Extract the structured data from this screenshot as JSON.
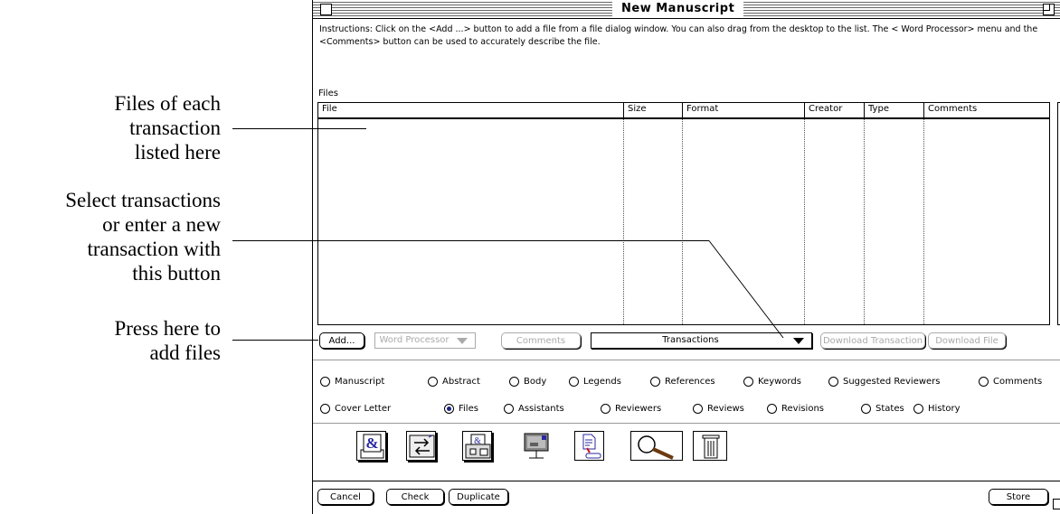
{
  "callouts": {
    "files": [
      "Files of each",
      "transaction",
      "listed here"
    ],
    "transactions": [
      "Select transactions",
      "or enter a new",
      "transaction with",
      "this button"
    ],
    "add": [
      "Press here to",
      "add files"
    ]
  },
  "window": {
    "title": "New Manuscript",
    "instructions": "Instructions: Click on the <Add ...> button to add a file from a file dialog window.  You can also drag from the desktop to the list.  The < Word Processor> menu and the <Comments> button can be used to accurately describe the file."
  },
  "files": {
    "label": "Files",
    "columns": [
      "File",
      "Size",
      "Format",
      "Creator",
      "Type",
      "Comments"
    ],
    "rows": []
  },
  "buttons": {
    "add": "Add...",
    "word_processor": "Word Processor",
    "comments": "Comments",
    "transactions": "Transactions",
    "download_transaction": "Download Transaction",
    "download_file": "Download File",
    "cancel": "Cancel",
    "check": "Check",
    "duplicate": "Duplicate",
    "store": "Store"
  },
  "sections_row1": [
    "Manuscript",
    "Abstract",
    "Body",
    "Legends",
    "References",
    "Keywords",
    "Suggested Reviewers",
    "Comments"
  ],
  "sections_row2": [
    "Cover Letter",
    "Files",
    "Assistants",
    "Reviewers",
    "Reviews",
    "Revisions",
    "States",
    "History"
  ],
  "selected_section": "Files",
  "toolbar_icons": [
    "word-document-icon",
    "transfer-icon",
    "print-icon",
    "email-icon",
    "file-export-icon",
    "magnifier-icon",
    "trash-icon"
  ],
  "colors": {
    "selected_radio": "#1a237e",
    "icon_accent": "#2a2aa0",
    "icon_red": "#d01010"
  }
}
